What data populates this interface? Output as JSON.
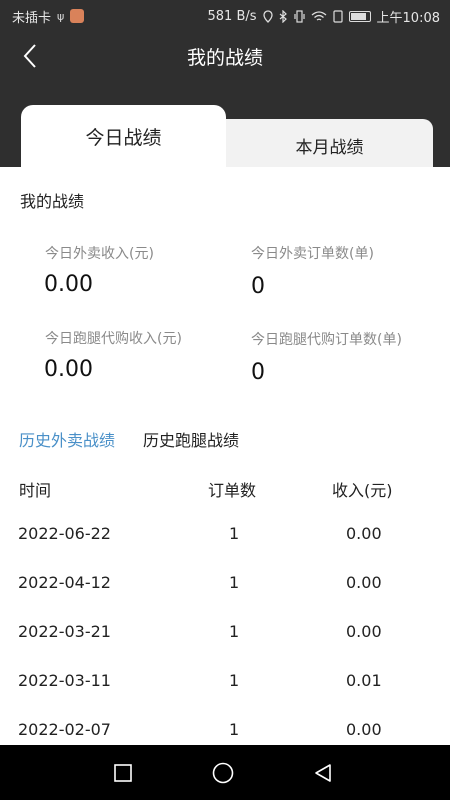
{
  "status_bar": {
    "carrier": "未插卡",
    "net_speed": "581 B/s",
    "time": "上午10:08"
  },
  "header": {
    "title": "我的战绩",
    "back_icon": "chevron-left-icon",
    "tabs": [
      {
        "label": "今日战绩",
        "active": true
      },
      {
        "label": "本月战绩",
        "active": false
      }
    ]
  },
  "stats": {
    "section_title": "我的战绩",
    "items": [
      {
        "label": "今日外卖收入(元)",
        "value": "0.00"
      },
      {
        "label": "今日外卖订单数(单)",
        "value": "0"
      },
      {
        "label": "今日跑腿代购收入(元)",
        "value": "0.00"
      },
      {
        "label": "今日跑腿代购订单数(单)",
        "value": "0"
      }
    ]
  },
  "history": {
    "tabs": [
      {
        "label": "历史外卖战绩",
        "active": true
      },
      {
        "label": "历史跑腿战绩",
        "active": false
      }
    ],
    "columns": [
      "时间",
      "订单数",
      "收入(元)"
    ],
    "rows": [
      {
        "date": "2022-06-22",
        "orders": "1",
        "income": "0.00"
      },
      {
        "date": "2022-04-12",
        "orders": "1",
        "income": "0.00"
      },
      {
        "date": "2022-03-21",
        "orders": "1",
        "income": "0.00"
      },
      {
        "date": "2022-03-11",
        "orders": "1",
        "income": "0.01"
      },
      {
        "date": "2022-02-07",
        "orders": "1",
        "income": "0.00"
      }
    ]
  },
  "theme": {
    "header_bg": "#2f2f2f",
    "accent": "#4a90c8"
  }
}
